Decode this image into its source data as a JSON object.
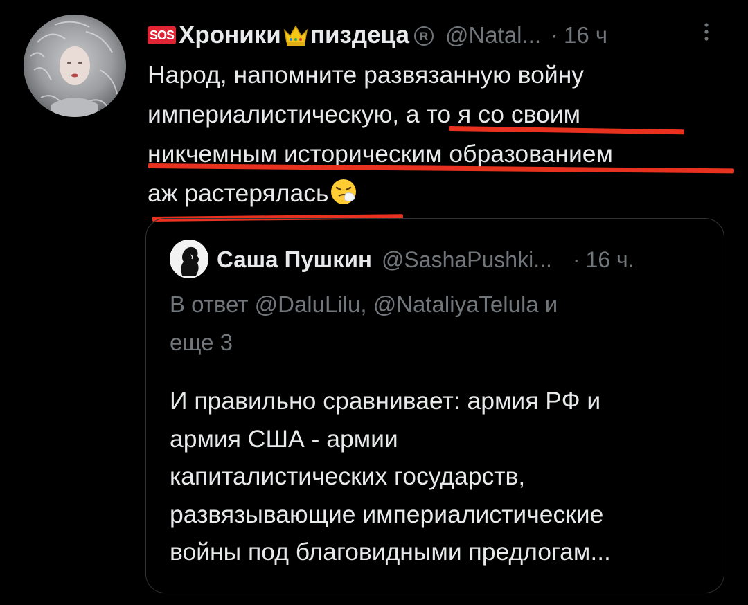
{
  "tweet": {
    "badge": "SOS",
    "name_part1": "Хроники",
    "name_part2": "пиздеца",
    "handle": "@Natal...",
    "separator": "·",
    "time": "16 ч",
    "text_lines": [
      "Народ, напомните развязанную войну",
      "империалистическую, а то я со своим",
      "никчемным историческим образованием",
      "аж растерялась"
    ],
    "icons": [
      "crown-icon",
      "registered-icon",
      "more-options-icon",
      "sneezing-face-emoji"
    ]
  },
  "quote": {
    "name": "Саша Пушкин",
    "handle": "@SashaPushki...",
    "separator": "·",
    "time": "16 ч.",
    "reply_lines": [
      "В ответ @DaluLilu, @NataliyaTelula и",
      "еще 3"
    ],
    "text_lines": [
      "И правильно сравнивает: армия РФ и",
      "армия США - армии",
      "капиталистических государств,",
      "развязывающие империалистические",
      "войны под благовидными предлогам..."
    ]
  },
  "colors": {
    "background": "#000000",
    "text": "#e7e9ea",
    "muted": "#71767b",
    "underline": "#e8321f",
    "border": "#2f3336"
  }
}
